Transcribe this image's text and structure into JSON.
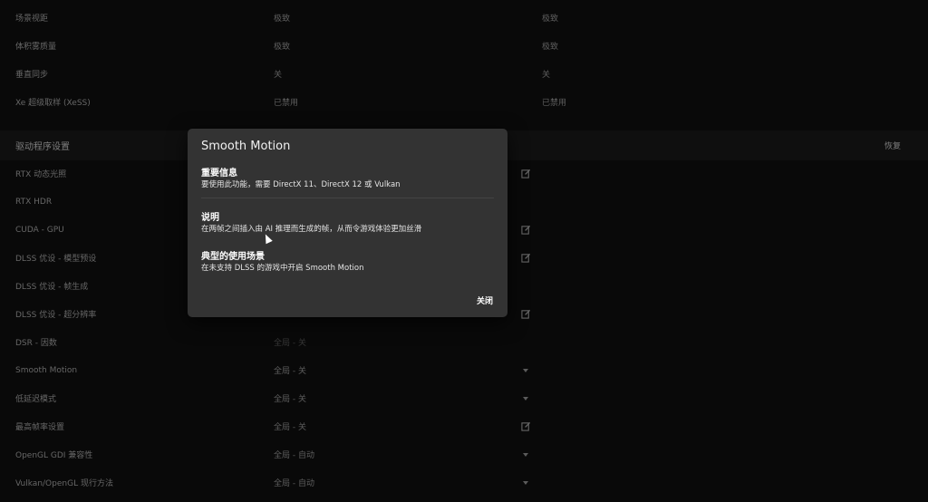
{
  "top_rows": [
    {
      "label": "场景视距",
      "global": "极致",
      "program": "极致"
    },
    {
      "label": "体积雾质量",
      "global": "极致",
      "program": "极致"
    },
    {
      "label": "垂直同步",
      "global": "关",
      "program": "关"
    },
    {
      "label": "Xe 超级取样 (XeSS)",
      "global": "已禁用",
      "program": "已禁用"
    }
  ],
  "section": {
    "title": "驱动程序设置",
    "restore_label": "恢复"
  },
  "driver_rows": [
    {
      "label": "RTX 动态光照",
      "value": "",
      "control": "edit-icon"
    },
    {
      "label": "RTX HDR",
      "value": "",
      "control": ""
    },
    {
      "label": "CUDA - GPU",
      "value": "",
      "control": "edit-icon"
    },
    {
      "label": "DLSS 优设 - 模型预设",
      "value": "",
      "control": "edit-icon"
    },
    {
      "label": "DLSS 优设 - 帧生成",
      "value": "",
      "control": ""
    },
    {
      "label": "DLSS 优设 - 超分辨率",
      "value": "",
      "control": "edit-icon"
    },
    {
      "label": "DSR - 因数",
      "value": "全局 - 关",
      "control": ""
    },
    {
      "label": "Smooth Motion",
      "value": "全局 - 关",
      "control": "chevron-down-icon"
    },
    {
      "label": "低延迟模式",
      "value": "全局 - 关",
      "control": "chevron-down-icon"
    },
    {
      "label": "最高帧率设置",
      "value": "全局 - 关",
      "control": "edit-icon"
    },
    {
      "label": "OpenGL GDI 兼容性",
      "value": "全局 - 自动",
      "control": "chevron-down-icon"
    },
    {
      "label": "Vulkan/OpenGL 现行方法",
      "value": "全局 - 自动",
      "control": "chevron-down-icon"
    }
  ],
  "modal": {
    "title": "Smooth Motion",
    "important_heading": "重要信息",
    "important_text": "要使用此功能，需要 DirectX 11、DirectX 12 或 Vulkan",
    "desc_heading": "说明",
    "desc_text": "在两帧之间插入由 AI 推理而生成的帧，从而令游戏体验更加丝滑",
    "usage_heading": "典型的使用场景",
    "usage_text": "在未支持 DLSS 的游戏中开启 Smooth Motion",
    "close_label": "关闭"
  },
  "colors": {
    "background": "#0c0c0c",
    "modal": "#333333",
    "section": "#141414"
  }
}
